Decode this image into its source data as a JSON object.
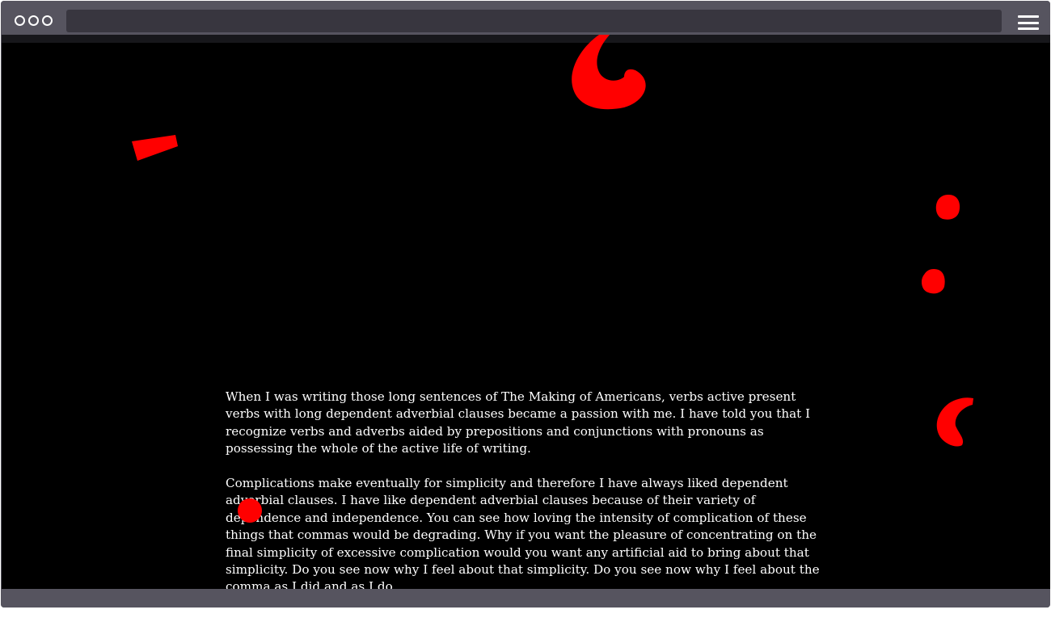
{
  "browser": {
    "traffic_lights": [
      "window-dot",
      "window-dot",
      "window-dot"
    ],
    "menu_icon": "hamburger-menu-icon"
  },
  "article": {
    "paragraphs": [
      "When I was writing those long sentences of The Making of Americans, verbs active present verbs with long dependent adverbial clauses became a passion with me. I have told you that I recognize verbs and adverbs aided by prepositions and conjunctions with pronouns as possessing the whole of the active life of writing.",
      "Complications make eventually for simplicity and therefore I have always liked dependent adverbial clauses. I have like dependent adverbial clauses because of their variety of dependence and independence. You can see how loving the intensity of complication of these things that commas would be degrading. Why if you want the pleasure of concentrating on the final simplicity of excessive complication would you want any artificial aid to bring about that simplicity. Do you see now why I feel about that simplicity. Do you see now why I feel about the comma as I did and as I do."
    ]
  },
  "decor": {
    "color": "#ff0000",
    "marks": [
      "comma-mark",
      "wedge-mark",
      "colon-dot-upper",
      "colon-dot-lower",
      "small-comma-mark",
      "round-dot-mark"
    ]
  }
}
